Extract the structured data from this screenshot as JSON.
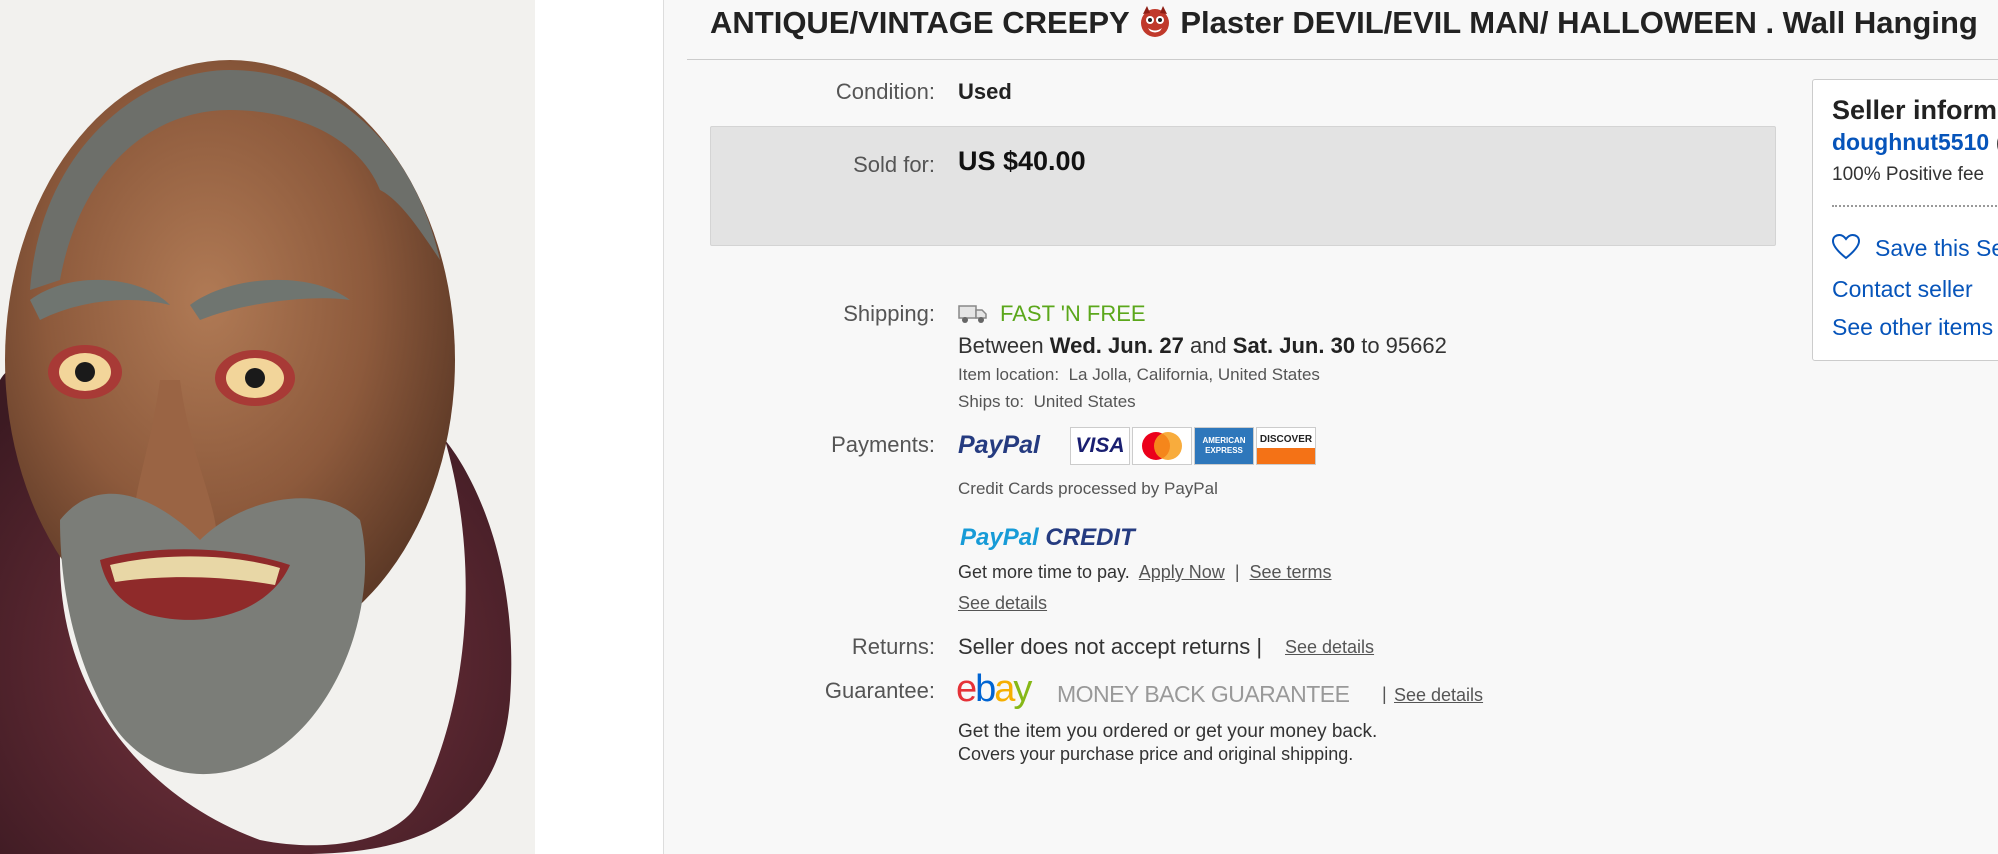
{
  "listing": {
    "title_prefix": "ANTIQUE/VINTAGE CREEPY ",
    "title_suffix": "Plaster DEVIL/EVIL MAN/ HALLOWEEN . Wall Hanging",
    "title_emoji_icon": "devil-face-icon"
  },
  "details": {
    "condition_label": "Condition:",
    "condition_value": "Used",
    "sold_label": "Sold for:",
    "sold_value": "US $40.00",
    "shipping_label": "Shipping:",
    "shipping_badge": "FAST 'N FREE",
    "delivery_between": "Between",
    "delivery_start": "Wed. Jun. 27",
    "delivery_and": "and",
    "delivery_end": "Sat. Jun. 30",
    "delivery_to": "to 95662",
    "item_location_label": "Item location:",
    "item_location_value": "La Jolla, California, United States",
    "ships_to_label": "Ships to:",
    "ships_to_value": "United States",
    "payments_label": "Payments:",
    "paypal_logo": "PayPal",
    "card_visa": "VISA",
    "card_amex": "AMERICAN EXPRESS",
    "card_discover": "DISCOVER",
    "credit_note": "Credit Cards processed by PayPal",
    "paypal_credit_1": "PayPal",
    "paypal_credit_2": "CREDIT",
    "more_time": "Get more time to pay.",
    "apply_now": "Apply Now",
    "see_terms": "See terms",
    "see_details_credit": "See details",
    "returns_label": "Returns:",
    "returns_value": "Seller does not accept returns |",
    "returns_details": "See details",
    "guarantee_label": "Guarantee:",
    "ebay_e": "e",
    "ebay_b": "b",
    "ebay_a": "a",
    "ebay_y": "y",
    "money_back": "MONEY BACK GUARANTEE",
    "guarantee_details": "See details",
    "guarantee_line1": "Get the item you ordered or get your money back.",
    "guarantee_line2": "Covers your purchase price and original shipping."
  },
  "seller": {
    "heading": "Seller inform",
    "name": "doughnut5510",
    "name_suffix": "(",
    "feedback": "100% Positive fee",
    "save": "Save this Se",
    "contact": "Contact seller",
    "other": "See other items"
  },
  "colors": {
    "fast_free": "#5ba71b",
    "link_blue": "#0654ba",
    "sold_box": "#e3e3e3"
  }
}
